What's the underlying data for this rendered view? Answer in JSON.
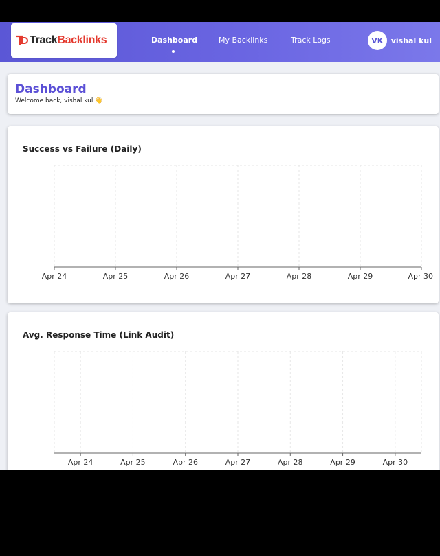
{
  "navbar": {
    "logo": {
      "text_dark": "Track",
      "text_red": "Backlinks"
    },
    "links": [
      {
        "label": "Dashboard",
        "active": true
      },
      {
        "label": "My Backlinks",
        "active": false
      },
      {
        "label": "Track Logs",
        "active": false
      }
    ],
    "user": {
      "initials": "VK",
      "name": "vishal kul"
    }
  },
  "header": {
    "title": "Dashboard",
    "welcome": "Welcome back, vishal kul 👋"
  },
  "colors": {
    "accent": "#5b57d6",
    "brand_red": "#e43a2f"
  },
  "chart_data": [
    {
      "type": "line",
      "title": "Success vs Failure (Daily)",
      "categories": [
        "Apr 24",
        "Apr 25",
        "Apr 26",
        "Apr 27",
        "Apr 28",
        "Apr 29",
        "Apr 30"
      ],
      "series": [],
      "grid": true
    },
    {
      "type": "line",
      "title": "Avg. Response Time (Link Audit)",
      "categories": [
        "Apr 24",
        "Apr 25",
        "Apr 26",
        "Apr 27",
        "Apr 28",
        "Apr 29",
        "Apr 30"
      ],
      "series": [],
      "grid": true
    }
  ]
}
